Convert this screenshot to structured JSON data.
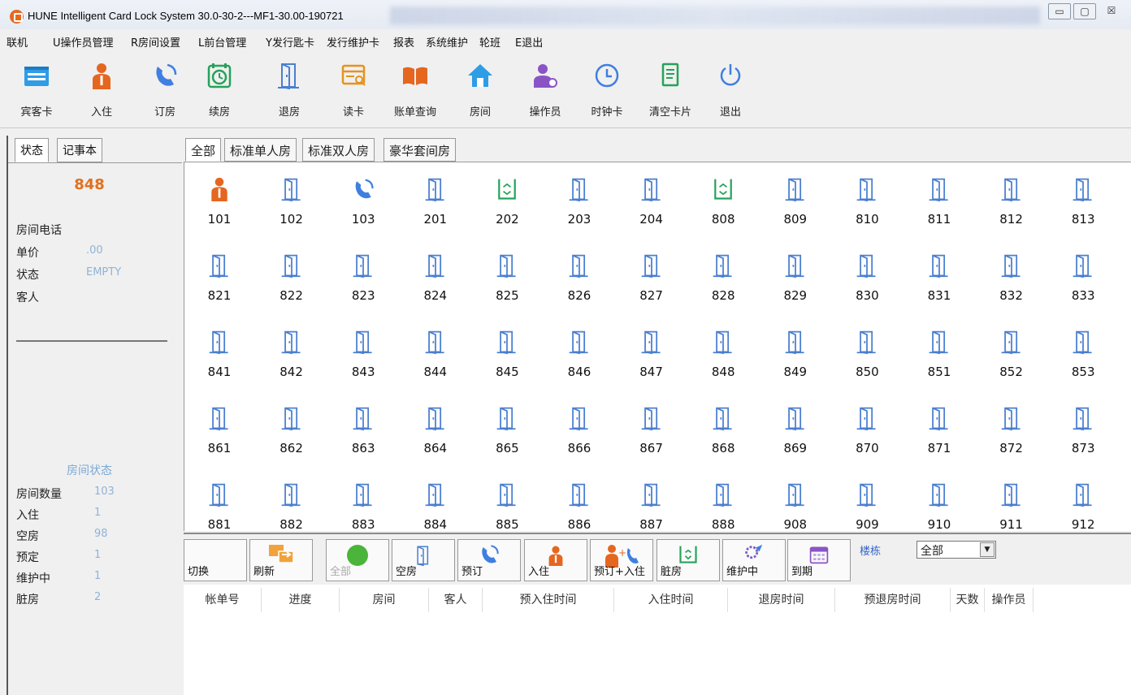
{
  "window": {
    "title": "HUNE Intelligent Card Lock System 30.0-30-2---MF1-30.00-190721",
    "buttons": {
      "minimize": "▭",
      "maximize": "▢",
      "close": "☒"
    }
  },
  "menu": [
    "联机",
    "U操作员管理",
    "R房间设置",
    "L前台管理",
    "Y发行匙卡",
    "发行维护卡",
    "报表",
    "系统维护",
    "轮班",
    "E退出"
  ],
  "toolbar": [
    {
      "label": "宾客卡",
      "icon": "guest-card-icon"
    },
    {
      "label": "入住",
      "icon": "person-icon"
    },
    {
      "label": "订房",
      "icon": "phone-icon"
    },
    {
      "label": "续房",
      "icon": "renew-clock-icon"
    },
    {
      "label": "退房",
      "icon": "door-icon"
    },
    {
      "label": "读卡",
      "icon": "read-card-icon"
    },
    {
      "label": "账单查询",
      "icon": "book-icon"
    },
    {
      "label": "房间",
      "icon": "home-icon"
    },
    {
      "label": "操作员",
      "icon": "operator-icon"
    },
    {
      "label": "时钟卡",
      "icon": "clock-icon"
    },
    {
      "label": "清空卡片",
      "icon": "clear-card-icon"
    },
    {
      "label": "退出",
      "icon": "power-icon"
    }
  ],
  "left_panel": {
    "tabs": [
      "状态",
      "记事本"
    ],
    "room_number": "848",
    "fields": [
      {
        "label": "房间电话",
        "value": ""
      },
      {
        "label": "单价",
        "value": ".00"
      },
      {
        "label": "状态",
        "value": "EMPTY"
      },
      {
        "label": "客人",
        "value": ""
      }
    ],
    "summary_title": "房间状态",
    "summary": [
      {
        "label": "房间数量",
        "value": "103"
      },
      {
        "label": "入住",
        "value": "1"
      },
      {
        "label": "空房",
        "value": "98"
      },
      {
        "label": "预定",
        "value": "1"
      },
      {
        "label": "维护中",
        "value": "1"
      },
      {
        "label": "脏房",
        "value": "2"
      }
    ]
  },
  "room_tabs": [
    "全部",
    "标准单人房",
    "标准双人房",
    "豪华套间房"
  ],
  "rooms": [
    {
      "no": "101",
      "status": "occupied"
    },
    {
      "no": "102",
      "status": "empty"
    },
    {
      "no": "103",
      "status": "reserved"
    },
    {
      "no": "201",
      "status": "empty"
    },
    {
      "no": "202",
      "status": "dirty"
    },
    {
      "no": "203",
      "status": "empty"
    },
    {
      "no": "204",
      "status": "empty"
    },
    {
      "no": "808",
      "status": "dirty"
    },
    {
      "no": "809",
      "status": "empty"
    },
    {
      "no": "810",
      "status": "empty"
    },
    {
      "no": "811",
      "status": "empty"
    },
    {
      "no": "812",
      "status": "empty"
    },
    {
      "no": "813",
      "status": "empty"
    },
    {
      "no": "821",
      "status": "empty"
    },
    {
      "no": "822",
      "status": "empty"
    },
    {
      "no": "823",
      "status": "empty"
    },
    {
      "no": "824",
      "status": "empty"
    },
    {
      "no": "825",
      "status": "empty"
    },
    {
      "no": "826",
      "status": "empty"
    },
    {
      "no": "827",
      "status": "empty"
    },
    {
      "no": "828",
      "status": "empty"
    },
    {
      "no": "829",
      "status": "empty"
    },
    {
      "no": "830",
      "status": "empty"
    },
    {
      "no": "831",
      "status": "empty"
    },
    {
      "no": "832",
      "status": "empty"
    },
    {
      "no": "833",
      "status": "empty"
    },
    {
      "no": "841",
      "status": "empty"
    },
    {
      "no": "842",
      "status": "empty"
    },
    {
      "no": "843",
      "status": "empty"
    },
    {
      "no": "844",
      "status": "empty"
    },
    {
      "no": "845",
      "status": "empty"
    },
    {
      "no": "846",
      "status": "empty"
    },
    {
      "no": "847",
      "status": "empty"
    },
    {
      "no": "848",
      "status": "empty"
    },
    {
      "no": "849",
      "status": "empty"
    },
    {
      "no": "850",
      "status": "empty"
    },
    {
      "no": "851",
      "status": "empty"
    },
    {
      "no": "852",
      "status": "empty"
    },
    {
      "no": "853",
      "status": "empty"
    },
    {
      "no": "861",
      "status": "empty"
    },
    {
      "no": "862",
      "status": "empty"
    },
    {
      "no": "863",
      "status": "empty"
    },
    {
      "no": "864",
      "status": "empty"
    },
    {
      "no": "865",
      "status": "empty"
    },
    {
      "no": "866",
      "status": "empty"
    },
    {
      "no": "867",
      "status": "empty"
    },
    {
      "no": "868",
      "status": "empty"
    },
    {
      "no": "869",
      "status": "empty"
    },
    {
      "no": "870",
      "status": "empty"
    },
    {
      "no": "871",
      "status": "empty"
    },
    {
      "no": "872",
      "status": "empty"
    },
    {
      "no": "873",
      "status": "empty"
    },
    {
      "no": "881",
      "status": "empty"
    },
    {
      "no": "882",
      "status": "empty"
    },
    {
      "no": "883",
      "status": "empty"
    },
    {
      "no": "884",
      "status": "empty"
    },
    {
      "no": "885",
      "status": "empty"
    },
    {
      "no": "886",
      "status": "empty"
    },
    {
      "no": "887",
      "status": "empty"
    },
    {
      "no": "888",
      "status": "empty"
    },
    {
      "no": "908",
      "status": "empty"
    },
    {
      "no": "909",
      "status": "empty"
    },
    {
      "no": "910",
      "status": "empty"
    },
    {
      "no": "911",
      "status": "empty"
    },
    {
      "no": "912",
      "status": "empty"
    }
  ],
  "status_buttons": [
    {
      "label": "切换",
      "icon": "none"
    },
    {
      "label": "刷新",
      "icon": "refresh-icon"
    },
    {
      "label": "全部",
      "icon": "green-dot-icon"
    },
    {
      "label": "空房",
      "icon": "door-icon"
    },
    {
      "label": "预订",
      "icon": "phone-icon"
    },
    {
      "label": "入住",
      "icon": "person-icon"
    },
    {
      "label": "预订+入住",
      "icon": "person-phone-icon"
    },
    {
      "label": "脏房",
      "icon": "dirty-bin-icon"
    },
    {
      "label": "维护中",
      "icon": "maintenance-icon"
    },
    {
      "label": "到期",
      "icon": "calendar-icon"
    }
  ],
  "building": {
    "label": "楼栋",
    "value": "全部"
  },
  "table_headers": [
    "帐单号",
    "进度",
    "房间",
    "客人",
    "预入住时间",
    "入住时间",
    "退房时间",
    "预退房时间",
    "天数",
    "操作员"
  ],
  "colors": {
    "door": "#4a7fd0",
    "occupied": "#e5661f",
    "reserved": "#3f7fe0",
    "dirty": "#25a25a",
    "price_text": "#8fb3d6",
    "room_number_highlight": "#e0711d"
  }
}
